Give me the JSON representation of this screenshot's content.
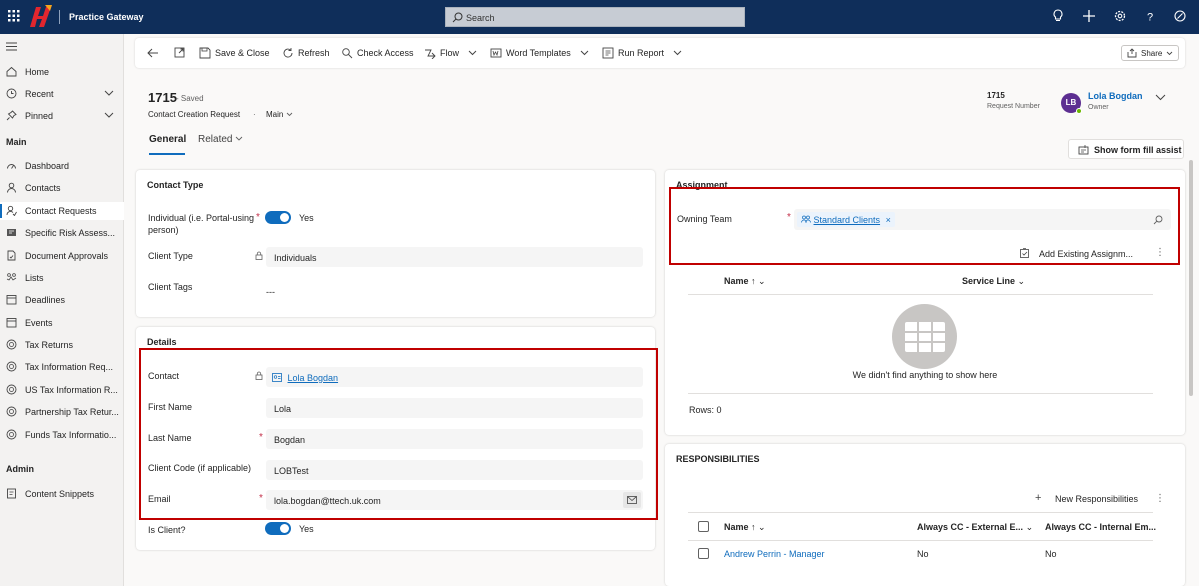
{
  "topbar": {
    "app_name": "Practice Gateway",
    "search_placeholder": "Search"
  },
  "sidebar": {
    "items_top": [
      {
        "label": "Home"
      },
      {
        "label": "Recent"
      },
      {
        "label": "Pinned"
      }
    ],
    "main_heading": "Main",
    "main_items": [
      {
        "label": "Dashboard"
      },
      {
        "label": "Contacts"
      },
      {
        "label": "Contact Requests"
      },
      {
        "label": "Specific Risk Assess..."
      },
      {
        "label": "Document Approvals"
      },
      {
        "label": "Lists"
      },
      {
        "label": "Deadlines"
      },
      {
        "label": "Events"
      },
      {
        "label": "Tax Returns"
      },
      {
        "label": "Tax Information Req..."
      },
      {
        "label": "US Tax Information R..."
      },
      {
        "label": "Partnership Tax Retur..."
      },
      {
        "label": "Funds Tax Informatio..."
      }
    ],
    "admin_heading": "Admin",
    "admin_items": [
      {
        "label": "Content Snippets"
      }
    ]
  },
  "commandbar": {
    "save_close": "Save & Close",
    "refresh": "Refresh",
    "check_access": "Check Access",
    "flow": "Flow",
    "word_templates": "Word Templates",
    "run_report": "Run Report",
    "share": "Share"
  },
  "header": {
    "record_id": "1715",
    "saved_status": "- Saved",
    "entity": "Contact Creation Request",
    "form_name": "Main",
    "tabs": [
      "General",
      "Related"
    ],
    "request_number": "1715",
    "request_number_label": "Request Number",
    "owner_name": "Lola Bogdan",
    "owner_label": "Owner",
    "owner_initials": "LB",
    "form_fill_assist": "Show form fill assist"
  },
  "contact_type": {
    "title": "Contact Type",
    "individual_label": "Individual (i.e. Portal-using person)",
    "individual_value": "Yes",
    "client_type_label": "Client Type",
    "client_type_value": "Individuals",
    "client_tags_label": "Client Tags",
    "client_tags_value": "---"
  },
  "details": {
    "title": "Details",
    "contact_label": "Contact",
    "contact_value": "Lola Bogdan",
    "first_name_label": "First Name",
    "first_name_value": "Lola",
    "last_name_label": "Last Name",
    "last_name_value": "Bogdan",
    "client_code_label": "Client Code (if applicable)",
    "client_code_value": "LOBTest",
    "email_label": "Email",
    "email_value": "lola.bogdan@ttech.uk.com",
    "is_client_label": "Is Client?",
    "is_client_value": "Yes"
  },
  "assignment": {
    "title": "Assignment",
    "owning_team_label": "Owning Team",
    "owning_team_value": "Standard Clients",
    "add_existing": "Add Existing Assignm...",
    "col_name": "Name ↑",
    "col_service_line": "Service Line",
    "empty_text": "We didn't find anything to show here",
    "rows_count": "Rows: 0"
  },
  "responsibilities": {
    "title": "RESPONSIBILITIES",
    "new_button": "New Responsibilities",
    "col_name": "Name ↑",
    "col_cc_external": "Always CC - External E...",
    "col_cc_internal": "Always CC - Internal Em...",
    "rows": [
      {
        "name": "Andrew Perrin - Manager",
        "cc_external": "No",
        "cc_internal": "No"
      }
    ]
  }
}
